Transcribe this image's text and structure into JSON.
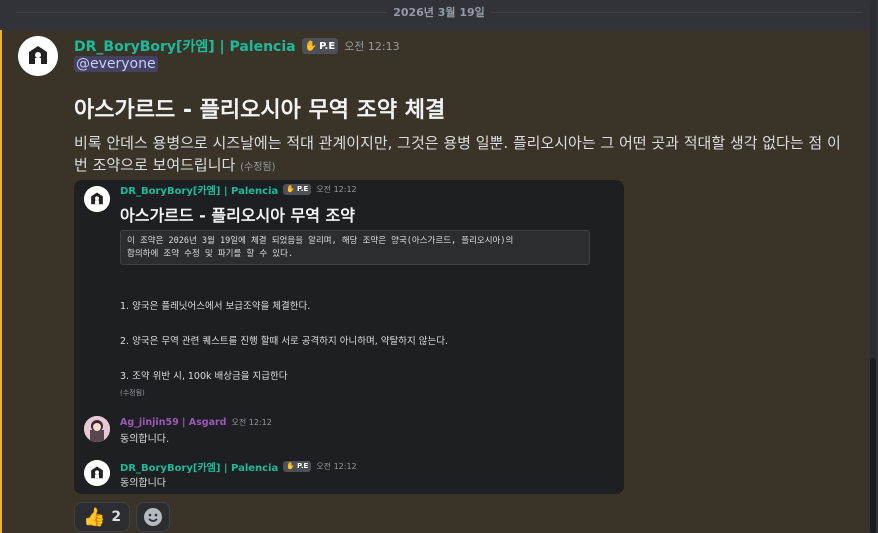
{
  "date_divider": "2026년 3월 19일",
  "message": {
    "author": "DR_BoryBory[카엠] | Palencia",
    "tag": "P.E",
    "timestamp": "오전 12:13",
    "mention": "@everyone",
    "heading": "아스가르드 - 플리오시아 무역 조약 체결",
    "body": "비록 안데스 용병으로 시즈날에는 적대 관계이지만, 그것은 용병 일뿐. 플리오시아는 그 어떤 곳과 적대할 생각 없다는 점 이번 조약으로 보여드립니다",
    "edited": "(수정됨)"
  },
  "embed": {
    "author": "DR_BoryBory[카엠] | Palencia",
    "tag": "P.E",
    "timestamp": "오전 12:12",
    "title": "아스가르드 - 플리오시아 무역 조약",
    "code_line1": "이 조약은 2026년 3월 19일에 체결 되었음을 알리며, 해당 조약은 양국(아스가르드, 플리오시아)의",
    "code_line2": "합의하에 조약 수정 및 파기를 할 수 있다.",
    "clause1": "1. 양국은 플레닛어스에서 보급조약을 체결한다.",
    "clause2": "2. 양국은 무역 관련 퀘스트를 진행 할때 서로 공격하지 아니하며, 약탈하지 않는다.",
    "clause3": "3. 조약 위반 시, 100k 배상금을 지급한다",
    "edited": "(수정됨)",
    "reply1_user": "Ag_jinjin59 | Asgard",
    "reply1_time": "오전 12:12",
    "reply1_text": "동의합니다.",
    "reply2_user": "DR_BoryBory[카엠] | Palencia",
    "reply2_tag": "P.E",
    "reply2_time": "오전 12:12",
    "reply2_text": "동의합니다"
  },
  "reactions": {
    "thumbs_up_count": "2"
  },
  "colors": {
    "background": "#313338",
    "mention_highlight": "#3a3428",
    "mention_bar": "#f0b232",
    "palencia_name": "#1abc9c",
    "asgard_name": "#9b59b6"
  },
  "icons": [
    "date-divider",
    "thumbs-up-icon",
    "add-reaction-icon",
    "avatar-icon"
  ]
}
